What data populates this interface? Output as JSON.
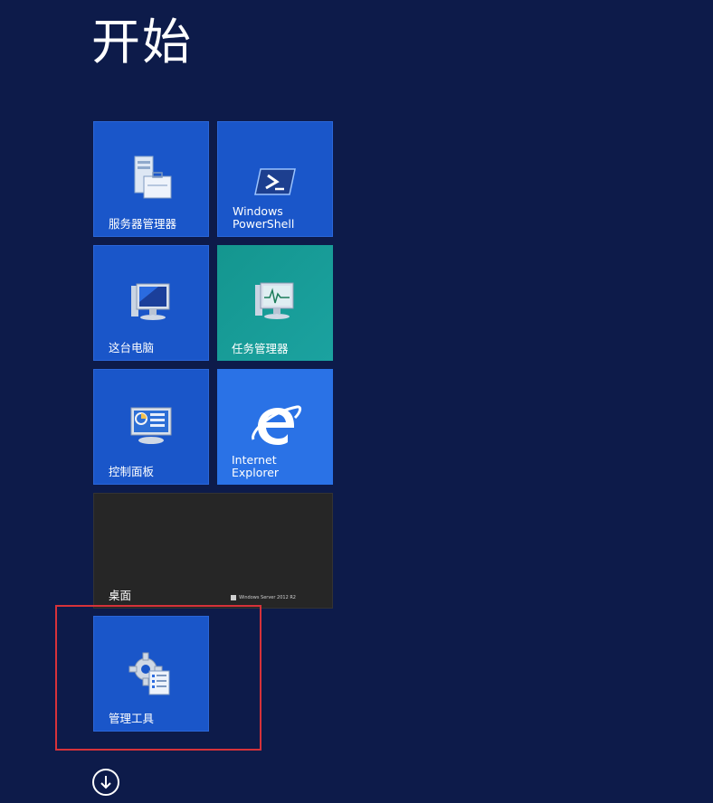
{
  "start": {
    "title": "开始"
  },
  "tiles": [
    {
      "id": "server-manager",
      "label": "服务器管理器",
      "icon": "server-manager-icon"
    },
    {
      "id": "powershell",
      "label": "Windows\nPowerShell",
      "icon": "powershell-icon"
    },
    {
      "id": "this-pc",
      "label": "这台电脑",
      "icon": "computer-icon"
    },
    {
      "id": "task-manager",
      "label": "任务管理器",
      "icon": "task-manager-icon"
    },
    {
      "id": "control-panel",
      "label": "控制面板",
      "icon": "control-panel-icon"
    },
    {
      "id": "internet-explorer",
      "label": "Internet\nExplorer",
      "icon": "internet-explorer-icon"
    },
    {
      "id": "desktop",
      "label": "桌面",
      "icon": "desktop-icon",
      "brand": "Windows Server 2012 R2"
    },
    {
      "id": "admin-tools",
      "label": "管理工具",
      "icon": "admin-tools-icon"
    }
  ],
  "navigation": {
    "all_apps_icon": "down-arrow-icon"
  },
  "colors": {
    "background": "#0d1b4a",
    "tile_blue": "#1a56c9",
    "tile_teal": "#14968f",
    "highlight": "#d6323a"
  }
}
